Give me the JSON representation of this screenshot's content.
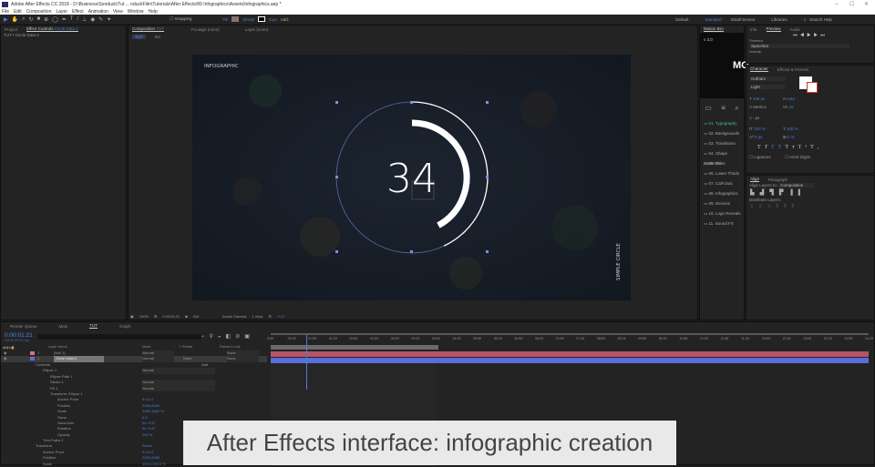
{
  "window": {
    "title": "Adobe After Effects CC 2018 - D:\\Business\\Sonduck\\Tut ... nduckFilm\\Tutorials\\After Effects\\89 Infographics\\Assets\\Infographics.aep *",
    "min": "–",
    "max": "☐",
    "close": "✕"
  },
  "menu": [
    "File",
    "Edit",
    "Composition",
    "Layer",
    "Effect",
    "Animation",
    "View",
    "Window",
    "Help"
  ],
  "toolbar": {
    "snapping": "Snapping",
    "fill": "Fill",
    "stroke": "Stroke",
    "stroke_width": "5 px",
    "add": "Add:",
    "workspaces": [
      "Default",
      "Standard",
      "Small Screen",
      "Libraries"
    ],
    "search_placeholder": "Search Help"
  },
  "project_panel": {
    "tab_project": "Project",
    "tab_effect": "Effect Controls",
    "effect_layer": "Circle Data 2",
    "breadcrumb": "TUT • Circle Data 2"
  },
  "comp_panel": {
    "tab": "Composition",
    "comp_name": "TUT",
    "footage": "Footage (none)",
    "layer": "Layer (none)",
    "crumbs": [
      "TUT",
      "BG"
    ],
    "zoom": "100%",
    "timecode": "0:00:01:21",
    "resolution": "Full",
    "camera": "Active Camera",
    "views": "1 View",
    "exposure": "+0.0"
  },
  "viewer": {
    "title_text": "INFOGRAPHIC",
    "number": "34",
    "side_text": "SIMPLE CIRCLE",
    "arc_fraction": 0.42,
    "outer_arc_fraction": 0.43
  },
  "motion_bro": {
    "tab": "Motion Bro",
    "version": "v 3.0",
    "logo": "MO",
    "folders": [
      "01. Typography",
      "02. Backgrounds",
      "03. Transitions",
      "04. Shape Elements",
      "05. Titles",
      "06. Lower Thirds",
      "07. Call-Outs",
      "08. Infographics",
      "09. Devices",
      "10. Logo Reveals",
      "11. Sound FX"
    ]
  },
  "preview": {
    "tabs": [
      "Info",
      "Preview",
      "Audio"
    ],
    "shortcut_label": "Shortcut",
    "shortcut": "Spacebar",
    "include": "Include:"
  },
  "character": {
    "tabs": [
      "Character",
      "Effects & Presets"
    ],
    "font": "Gotham",
    "style": "Light",
    "size": "105 px",
    "leading": "Auto",
    "kerning": "Metrics",
    "tracking": "15",
    "stroke": "- px",
    "vscale": "100 %",
    "hscale": "100 %",
    "baseline": "0 px",
    "tsume": "0 %",
    "ligatures": "Ligatures",
    "hindi": "Hindi Digits"
  },
  "align": {
    "tabs": [
      "Align",
      "Paragraph"
    ],
    "align_to_label": "Align Layers to:",
    "align_to": "Composition",
    "distribute": "Distribute Layers:"
  },
  "timeline": {
    "tabs": [
      "Render Queue",
      "Main",
      "TUT",
      "Graph"
    ],
    "timecode": "0:00:01:21",
    "frames": "00045 (25.00 fps)",
    "columns": {
      "layer_name": "Layer Name",
      "mode": "Mode",
      "trkmat": "T TrkMat",
      "parent": "Parent & Link"
    },
    "layers": [
      {
        "num": "1",
        "name": "[Null 1]",
        "mode": "Normal",
        "trkmat": "",
        "parent": "None",
        "color": "#e06b8a"
      },
      {
        "num": "2",
        "name": "Circle Data 2",
        "mode": "Normal",
        "trkmat": "None",
        "parent": "None",
        "color": "#5b6be0"
      }
    ],
    "props": [
      {
        "label": "Contents",
        "indent": 1,
        "value": "",
        "add": "Add:"
      },
      {
        "label": "Ellipse 1",
        "indent": 2,
        "value": "Normal"
      },
      {
        "label": "Ellipse Path 1",
        "indent": 3,
        "value": ""
      },
      {
        "label": "Stroke 1",
        "indent": 3,
        "value": "Normal"
      },
      {
        "label": "Fill 1",
        "indent": 3,
        "value": "Normal"
      },
      {
        "label": "Transform: Ellipse 1",
        "indent": 3,
        "value": ""
      },
      {
        "label": "Anchor Point",
        "indent": 4,
        "value": "0.0,0.0"
      },
      {
        "label": "Position",
        "indent": 4,
        "value": "2265,2265"
      },
      {
        "label": "Scale",
        "indent": 4,
        "value": "1460,1460 %"
      },
      {
        "label": "Skew",
        "indent": 4,
        "value": "0.0"
      },
      {
        "label": "Skew Axis",
        "indent": 4,
        "value": "0x +0.0°"
      },
      {
        "label": "Rotation",
        "indent": 4,
        "value": "0x +0.0°"
      },
      {
        "label": "Opacity",
        "indent": 4,
        "value": "100 %"
      },
      {
        "label": "Trim Paths 1",
        "indent": 2,
        "value": ""
      },
      {
        "label": "Transform",
        "indent": 1,
        "value": "Reset"
      },
      {
        "label": "Anchor Point",
        "indent": 2,
        "value": "0.0,0.0"
      },
      {
        "label": "Position",
        "indent": 2,
        "value": "2265,2065"
      },
      {
        "label": "Scale",
        "indent": 2,
        "value": "100.0,100.0 %"
      }
    ],
    "ruler": [
      "0:00f",
      "00:12f",
      "01:00f",
      "01:12f",
      "02:00f",
      "02:12f",
      "03:00f",
      "03:12f",
      "04:00f",
      "04:12f",
      "05:00f",
      "05:12f",
      "06:00f",
      "06:12f",
      "07:00f",
      "07:12f",
      "08:00f",
      "08:12f",
      "09:00f",
      "09:12f",
      "10:00f",
      "10:12f",
      "11:00f",
      "11:12f",
      "12:00f",
      "12:12f",
      "13:00f",
      "13:12f",
      "14:00f",
      "14:12f"
    ],
    "playhead_fraction": 0.059,
    "work_area_fraction": 0.28
  },
  "caption": "After Effects interface: infographic creation"
}
